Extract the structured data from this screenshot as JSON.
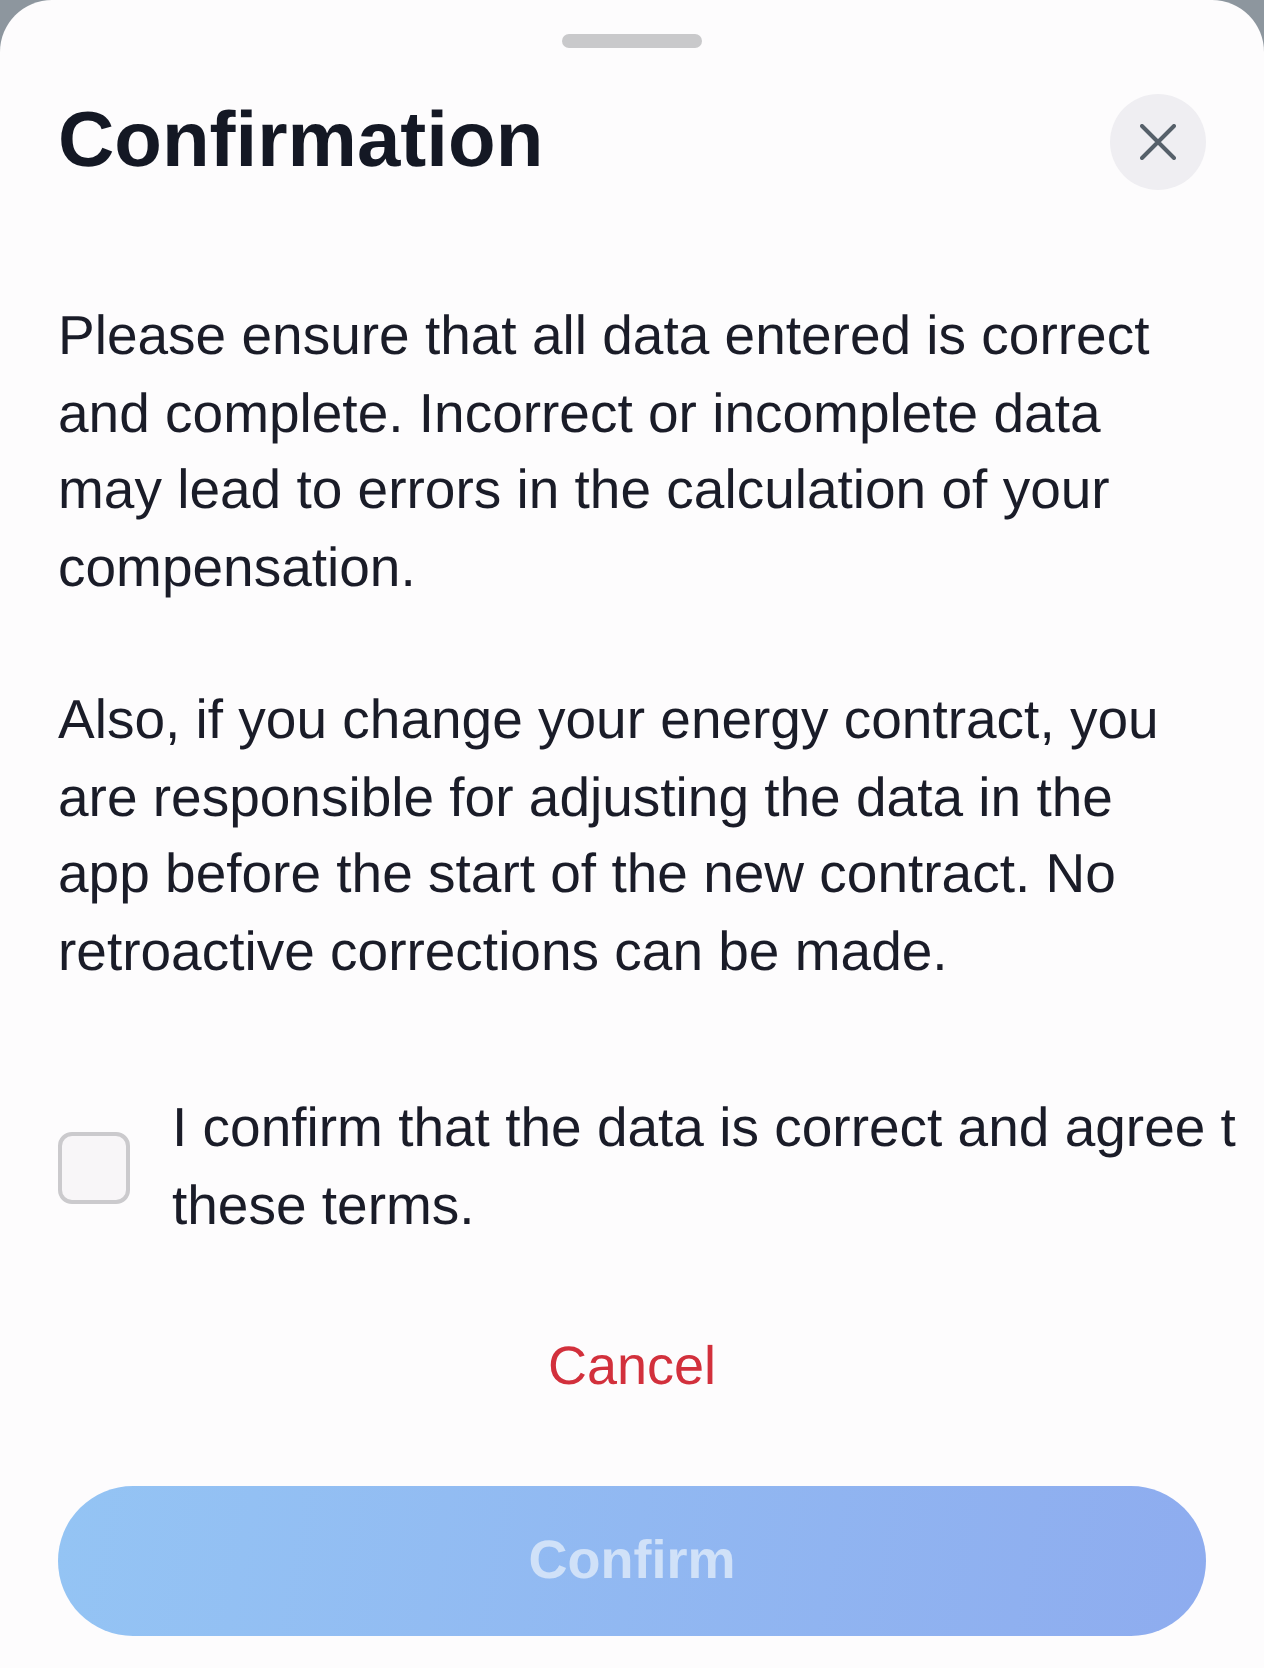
{
  "title": "Confirmation",
  "paragraphs": [
    "Please ensure that all data entered is correct and complete. Incorrect or incomplete data may lead to errors in the calculation of your compensation.",
    "Also, if you change your energy contract, you are responsible for adjusting the data in the app before the start of the new contract. No retroactive corrections can be made."
  ],
  "agreement": {
    "label": "I confirm that the data is correct and agree t these terms.",
    "checked": false
  },
  "cancel_button": {
    "label": "Cancel"
  },
  "confirm_button": {
    "label": "Confirm",
    "disabled": true
  }
}
